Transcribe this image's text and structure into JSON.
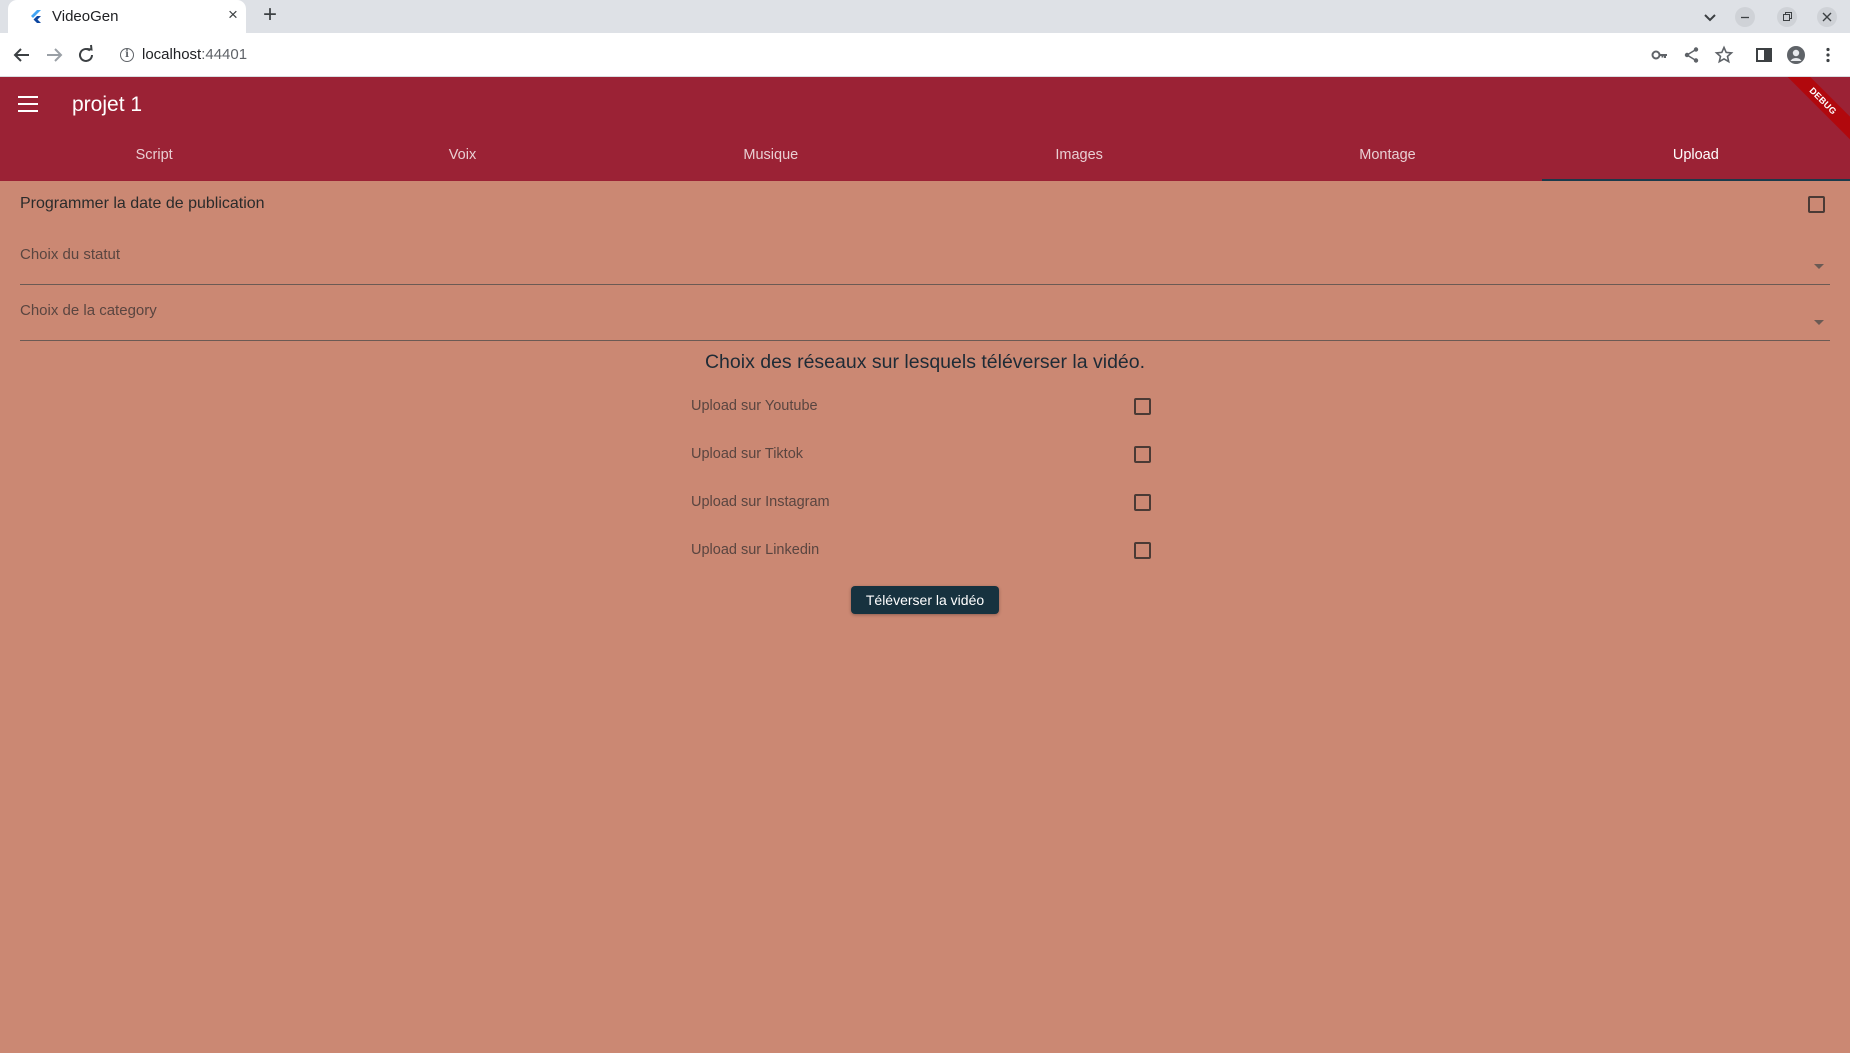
{
  "browser": {
    "tab_title": "VideoGen",
    "tab_close_label": "×",
    "new_tab_label": "+",
    "url_host": "localhost",
    "url_port": ":44401"
  },
  "app": {
    "title": "projet 1",
    "debug_banner": "DEBUG",
    "colors": {
      "appbar": "#9b2235",
      "background": "#cb8873",
      "button": "#17323f"
    },
    "tabs": [
      {
        "label": "Script"
      },
      {
        "label": "Voix"
      },
      {
        "label": "Musique"
      },
      {
        "label": "Images"
      },
      {
        "label": "Montage"
      },
      {
        "label": "Upload",
        "active": true
      }
    ]
  },
  "form": {
    "schedule_label": "Programmer la date de publication",
    "schedule_checked": false,
    "status_label": "Choix du statut",
    "category_label": "Choix de la category",
    "networks_heading": "Choix des réseaux sur lesquels téléverser la vidéo.",
    "networks": [
      {
        "label": "Upload sur Youtube",
        "checked": false
      },
      {
        "label": "Upload sur Tiktok",
        "checked": false
      },
      {
        "label": "Upload sur Instagram",
        "checked": false
      },
      {
        "label": "Upload sur Linkedin",
        "checked": false
      }
    ],
    "upload_button": "Téléverser la vidéo"
  }
}
